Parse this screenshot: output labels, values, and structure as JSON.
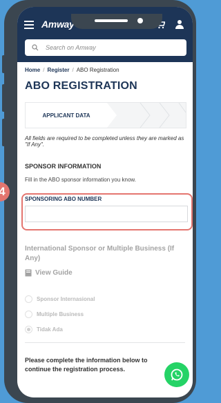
{
  "header": {
    "logo": "Amway",
    "search_placeholder": "Search on Amway"
  },
  "breadcrumb": {
    "home": "Home",
    "register": "Register",
    "current": "ABO Registration"
  },
  "page": {
    "title": "ABO REGISTRATION"
  },
  "stepper": {
    "active_step": "APPLICANT DATA"
  },
  "form": {
    "required_note": "All fields are required to be completed unless they are marked as \"If Any\".",
    "sponsor_section_title": "SPONSOR INFORMATION",
    "sponsor_section_desc": "Fill in the ABO sponsor information you know.",
    "sponsoring_abo_label": "SPONSORING ABO NUMBER",
    "sponsoring_abo_value": "",
    "intl_title": "International Sponsor or Multiple Business (If Any)",
    "view_guide": "View Guide",
    "options": [
      {
        "label": "Sponsor Internasional",
        "checked": false
      },
      {
        "label": "Multiple Business",
        "checked": false
      },
      {
        "label": "Tidak Ada",
        "checked": true
      }
    ],
    "bottom_note": "Please complete the information below to continue the registration process."
  },
  "annotation": {
    "step_number": "4",
    "highlight_color": "#e4756f"
  },
  "colors": {
    "header_bg": "#1d3557",
    "whatsapp": "#25d366",
    "frame": "#3b4650",
    "background": "#4f9bd6"
  }
}
